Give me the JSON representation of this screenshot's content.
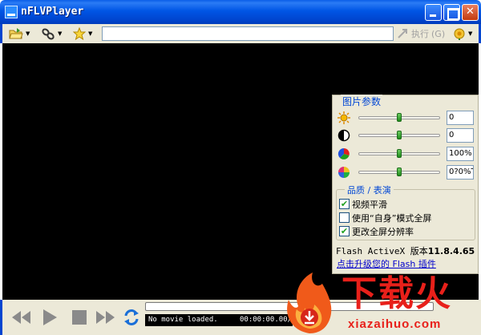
{
  "window": {
    "title": "nFLVPlayer"
  },
  "toolbar": {
    "url_value": "",
    "execute_label": "执行",
    "execute_shortcut": "(G)"
  },
  "panel": {
    "title": "图片参数",
    "sliders": [
      {
        "icon": "brightness-icon",
        "value": "0",
        "level": 0.5
      },
      {
        "icon": "contrast-icon",
        "value": "0",
        "level": 0.5
      },
      {
        "icon": "saturation-icon",
        "value": "100%",
        "level": 0.5
      },
      {
        "icon": "hue-icon",
        "value": "0?0%T",
        "level": 0.5
      }
    ],
    "group": {
      "title": "品质 / 表演",
      "options": [
        {
          "label": "视频平滑",
          "checked": true
        },
        {
          "label": "使用“自身”模式全屏",
          "checked": false
        },
        {
          "label": "更改全屏分辨率",
          "checked": true
        }
      ]
    },
    "flash_version_label": "Flash ActiveX 版本",
    "flash_version_number": "11.8.4.65",
    "flash_upgrade_link": "点击升级您的 Flash 插件"
  },
  "player": {
    "status_text": "No movie loaded.",
    "time_text": "00:00:00.00/",
    "progress": 0
  },
  "watermark": {
    "brand": "下载火",
    "url": "xiazaihuo.com"
  },
  "colors": {
    "titlebar": "#0055e5",
    "panel_bg": "#ece9d8",
    "accent_blue": "#0046d5",
    "watermark_red": "#e8201a"
  }
}
